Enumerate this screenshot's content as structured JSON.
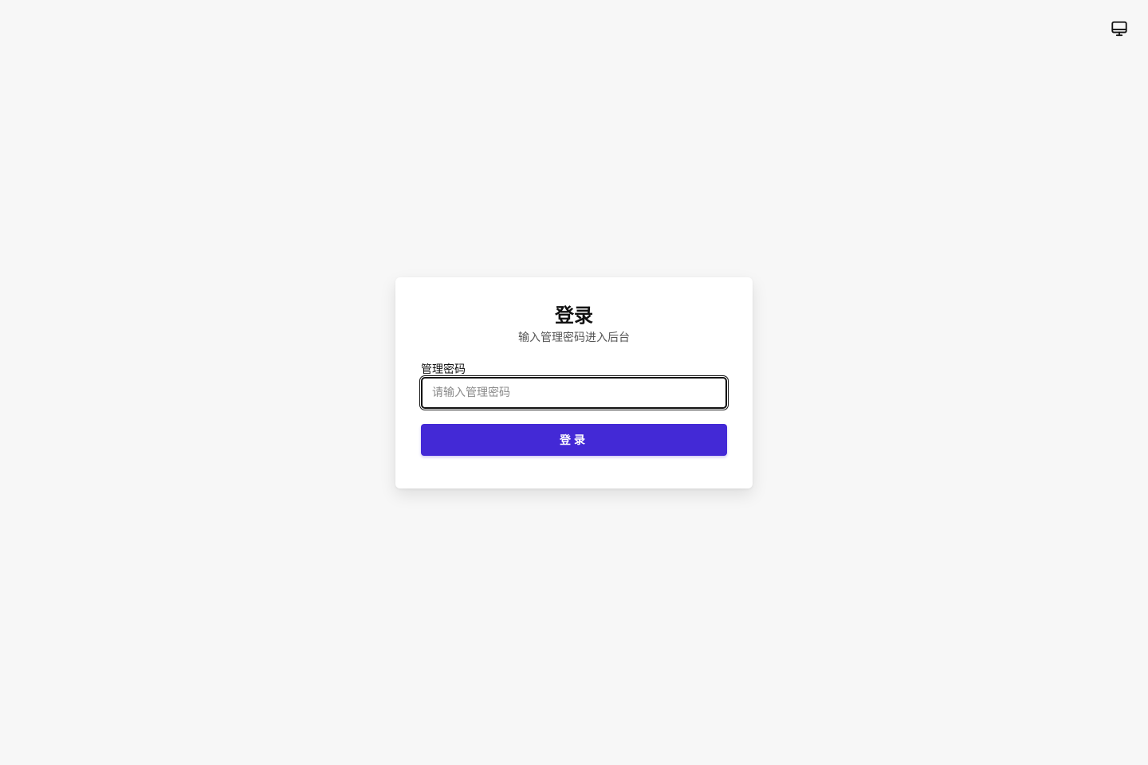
{
  "header": {
    "theme_toggle_icon": "monitor-icon"
  },
  "login": {
    "title": "登录",
    "subtitle": "输入管理密码进入后台",
    "password_label": "管理密码",
    "password_placeholder": "请输入管理密码",
    "password_value": "",
    "submit_label": "登录"
  },
  "colors": {
    "background": "#f7f7f7",
    "card": "#ffffff",
    "accent": "#4329d6",
    "text": "#111111",
    "muted": "#555555"
  }
}
